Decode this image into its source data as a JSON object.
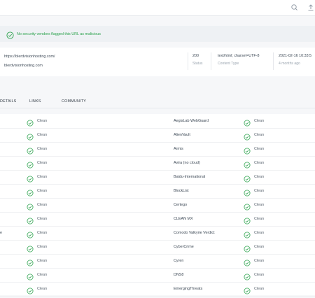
{
  "alert": {
    "text": "No security vendors flagged this URL as malicious",
    "color": "#2aa24b"
  },
  "info": {
    "url": "https://blerdvisionhosting.com/",
    "host": "blerdvisionhosting.com",
    "status_value": "200",
    "status_label": "Status",
    "content_type_value": "text/html; charset=UTF-8",
    "content_type_label": "Content Type",
    "date_value": "2021-02-16 10:33:5",
    "date_label": "4 months ago"
  },
  "tabs": [
    "DETAILS",
    "LINKS",
    "COMMUNITY"
  ],
  "topbar": {
    "icons": [
      "search-icon",
      "upload-icon"
    ]
  },
  "rows": [
    {
      "left_vendor": "",
      "left_result": "Clean",
      "right_vendor": "AegisLab WebGuard",
      "right_result": "Clean"
    },
    {
      "left_vendor": "",
      "left_result": "Clean",
      "right_vendor": "AlienVault",
      "right_result": "Clean"
    },
    {
      "left_vendor": "",
      "left_result": "Clean",
      "right_vendor": "Armis",
      "right_result": "Clean"
    },
    {
      "left_vendor": "",
      "left_result": "Clean",
      "right_vendor": "Avira (no cloud)",
      "right_result": "Clean"
    },
    {
      "left_vendor": "",
      "left_result": "Clean",
      "right_vendor": "Baidu-International",
      "right_result": "Clean"
    },
    {
      "left_vendor": "",
      "left_result": "Clean",
      "right_vendor": "BlockList",
      "right_result": "Clean"
    },
    {
      "left_vendor": "",
      "left_result": "Clean",
      "right_vendor": "Certego",
      "right_result": "Clean"
    },
    {
      "left_vendor": "",
      "left_result": "Clean",
      "right_vendor": "CLEAN MX",
      "right_result": "Clean"
    },
    {
      "left_vendor": "e",
      "left_result": "Clean",
      "right_vendor": "Comodo Valkyrie Verdict",
      "right_result": "Clean"
    },
    {
      "left_vendor": "",
      "left_result": "Clean",
      "right_vendor": "CyberCrime",
      "right_result": "Clean"
    },
    {
      "left_vendor": "",
      "left_result": "Clean",
      "right_vendor": "Cyren",
      "right_result": "Clean"
    },
    {
      "left_vendor": "",
      "left_result": "Clean",
      "right_vendor": "DNS8",
      "right_result": "Clean"
    },
    {
      "left_vendor": "",
      "left_result": "Clean",
      "right_vendor": "EmergingThreats",
      "right_result": "Clean"
    }
  ]
}
